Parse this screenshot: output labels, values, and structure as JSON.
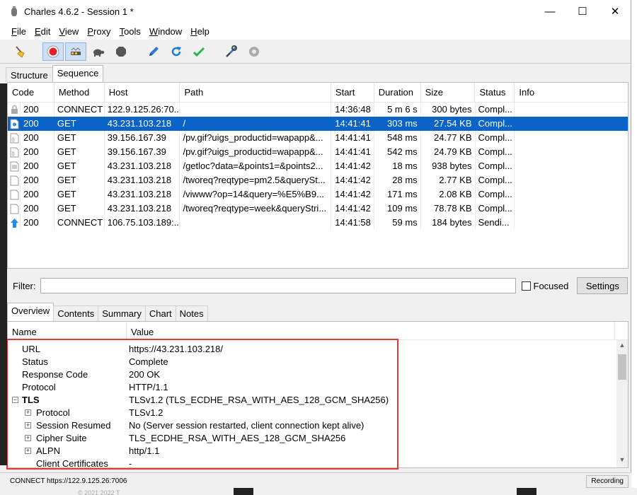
{
  "window": {
    "title": "Charles 4.6.2 - Session 1 *",
    "controls": {
      "minimize": "—",
      "maximize": "☐",
      "close": "✕"
    }
  },
  "menu": [
    {
      "label": "File",
      "accel": "F",
      "rest": "ile"
    },
    {
      "label": "Edit",
      "accel": "E",
      "rest": "dit"
    },
    {
      "label": "View",
      "accel": "V",
      "rest": "iew"
    },
    {
      "label": "Proxy",
      "accel": "P",
      "rest": "roxy"
    },
    {
      "label": "Tools",
      "accel": "T",
      "rest": "ools"
    },
    {
      "label": "Window",
      "accel": "W",
      "rest": "indow"
    },
    {
      "label": "Help",
      "accel": "H",
      "rest": "elp"
    }
  ],
  "toolbar": {
    "icons": [
      "broom-icon",
      "record-icon",
      "throttle-icon",
      "turtle-icon",
      "stop-icon",
      "pen-icon",
      "refresh-icon",
      "check-icon",
      "tools-icon",
      "settings-icon"
    ]
  },
  "top_tabs": [
    "Structure",
    "Sequence"
  ],
  "sequence": {
    "columns": [
      "Code",
      "Method",
      "Host",
      "Path",
      "Start",
      "Duration",
      "Size",
      "Status",
      "Info"
    ],
    "rows": [
      {
        "icon": "lock",
        "code": "200",
        "method": "CONNECT",
        "host": "122.9.125.26:70...",
        "path": "",
        "start": "14:36:48",
        "duration": "5 m 6 s",
        "size": "300 bytes",
        "status": "Compl...",
        "info": ""
      },
      {
        "icon": "html",
        "code": "200",
        "method": "GET",
        "host": "43.231.103.218",
        "path": "/",
        "start": "14:41:41",
        "duration": "303 ms",
        "size": "27.54 KB",
        "status": "Compl...",
        "info": "",
        "selected": true
      },
      {
        "icon": "json",
        "code": "200",
        "method": "GET",
        "host": "39.156.167.39",
        "path": "/pv.gif?uigs_productid=wapapp&...",
        "start": "14:41:41",
        "duration": "548 ms",
        "size": "24.77 KB",
        "status": "Compl...",
        "info": ""
      },
      {
        "icon": "json",
        "code": "200",
        "method": "GET",
        "host": "39.156.167.39",
        "path": "/pv.gif?uigs_productid=wapapp&...",
        "start": "14:41:41",
        "duration": "542 ms",
        "size": "24.79 KB",
        "status": "Compl...",
        "info": ""
      },
      {
        "icon": "doc",
        "code": "200",
        "method": "GET",
        "host": "43.231.103.218",
        "path": "/getloc?data=&points1=&points2...",
        "start": "14:41:42",
        "duration": "18 ms",
        "size": "938 bytes",
        "status": "Compl...",
        "info": ""
      },
      {
        "icon": "file",
        "code": "200",
        "method": "GET",
        "host": "43.231.103.218",
        "path": "/tworeq?reqtype=pm2.5&querySt...",
        "start": "14:41:42",
        "duration": "28 ms",
        "size": "2.77 KB",
        "status": "Compl...",
        "info": ""
      },
      {
        "icon": "file",
        "code": "200",
        "method": "GET",
        "host": "43.231.103.218",
        "path": "/viwww?op=14&query=%E5%B9...",
        "start": "14:41:42",
        "duration": "171 ms",
        "size": "2.08 KB",
        "status": "Compl...",
        "info": ""
      },
      {
        "icon": "file",
        "code": "200",
        "method": "GET",
        "host": "43.231.103.218",
        "path": "/tworeq?reqtype=week&queryStri...",
        "start": "14:41:42",
        "duration": "109 ms",
        "size": "78.78 KB",
        "status": "Compl...",
        "info": ""
      },
      {
        "icon": "upload",
        "code": "200",
        "method": "CONNECT",
        "host": "106.75.103.189:...",
        "path": "",
        "start": "14:41:58",
        "duration": "59 ms",
        "size": "184 bytes",
        "status": "Sendi...",
        "info": ""
      }
    ]
  },
  "filter": {
    "label": "Filter:",
    "value": "",
    "focused_label": "Focused",
    "settings_label": "Settings"
  },
  "bottom_tabs": [
    "Overview",
    "Contents",
    "Summary",
    "Chart",
    "Notes"
  ],
  "overview": {
    "columns": [
      "Name",
      "Value"
    ],
    "rows": [
      {
        "name": "URL",
        "value": "https://43.231.103.218/",
        "level": 0,
        "expander": ""
      },
      {
        "name": "Status",
        "value": "Complete",
        "level": 0,
        "expander": ""
      },
      {
        "name": "Response Code",
        "value": "200 OK",
        "level": 0,
        "expander": ""
      },
      {
        "name": "Protocol",
        "value": "HTTP/1.1",
        "level": 0,
        "expander": ""
      },
      {
        "name": "TLS",
        "value": "TLSv1.2 (TLS_ECDHE_RSA_WITH_AES_128_GCM_SHA256)",
        "level": 0,
        "expander": "−",
        "bold": true
      },
      {
        "name": "Protocol",
        "value": "TLSv1.2",
        "level": 1,
        "expander": "+"
      },
      {
        "name": "Session Resumed",
        "value": "No (Server session restarted, client connection kept alive)",
        "level": 1,
        "expander": "+"
      },
      {
        "name": "Cipher Suite",
        "value": "TLS_ECDHE_RSA_WITH_AES_128_GCM_SHA256",
        "level": 1,
        "expander": "+"
      },
      {
        "name": "ALPN",
        "value": "http/1.1",
        "level": 1,
        "expander": "+"
      },
      {
        "name": "Client Certificates",
        "value": "-",
        "level": 1,
        "expander": ""
      }
    ]
  },
  "statusbar": {
    "text": "CONNECT https://122.9.125.26:7006",
    "recording": "Recording"
  },
  "desktop": {
    "footer_text": "© 2021 2022 T"
  },
  "colors": {
    "selection": "#0a64c8",
    "highlight_border": "#e53935",
    "record_red": "#e0202a"
  }
}
